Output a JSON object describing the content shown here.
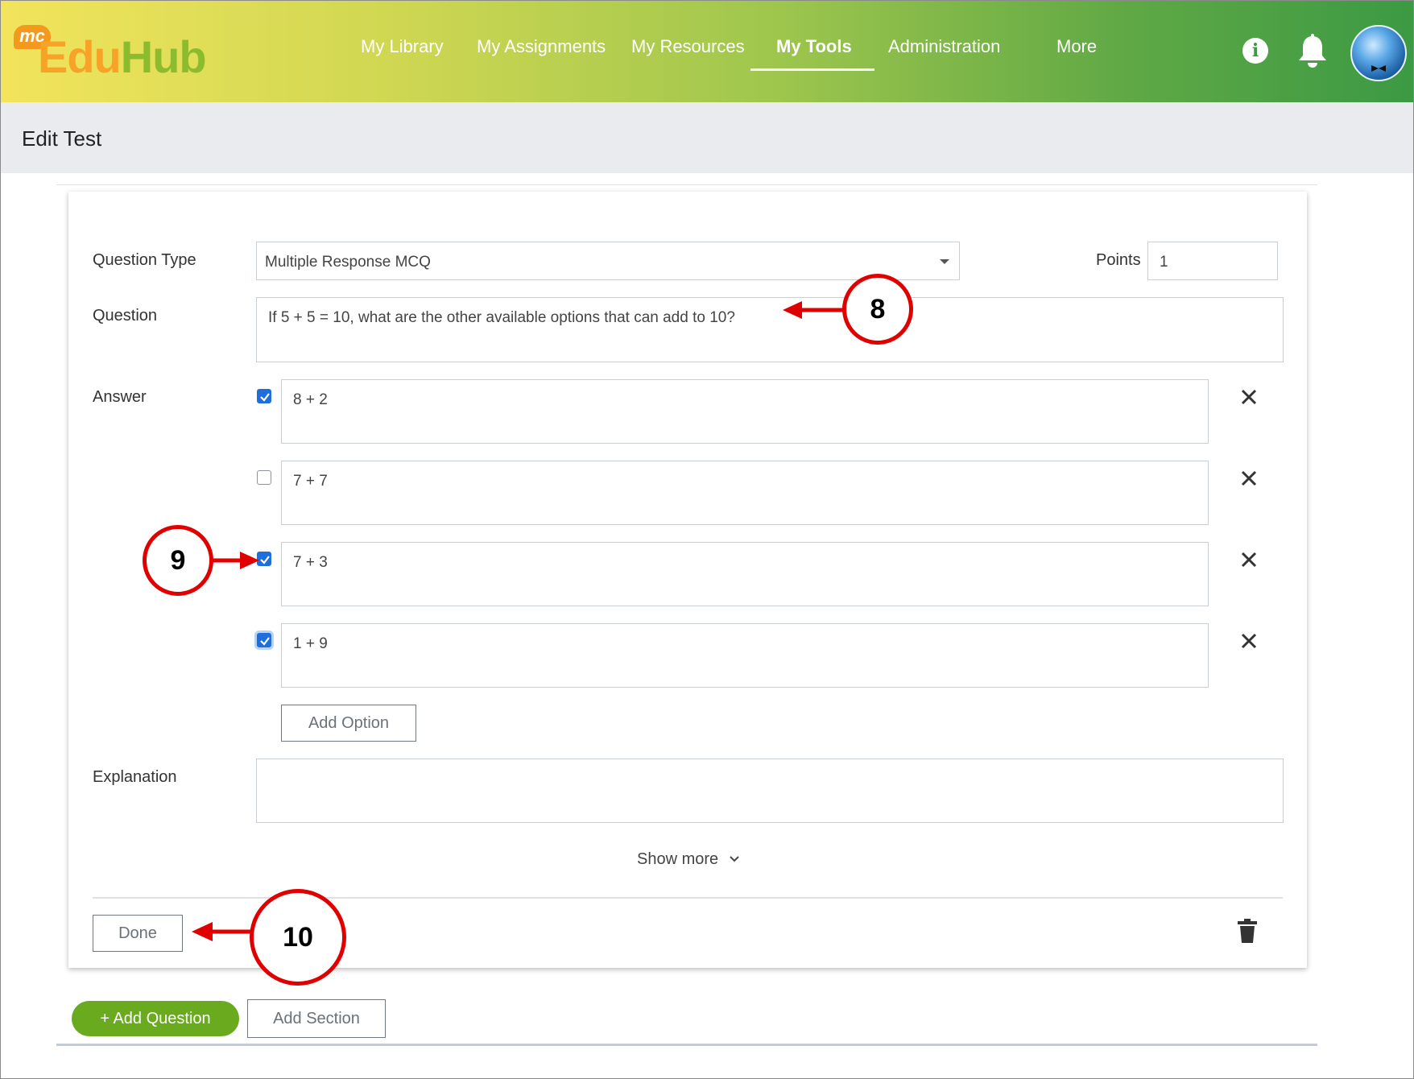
{
  "app": {
    "logo_badge": "mc",
    "logo_part1": "Edu",
    "logo_part2": "Hub"
  },
  "nav": {
    "items": [
      {
        "label": "My Library"
      },
      {
        "label": "My Assignments"
      },
      {
        "label": "My Resources"
      },
      {
        "label": "My Tools",
        "active": true
      },
      {
        "label": "Administration"
      },
      {
        "label": "More"
      }
    ]
  },
  "header_icons": {
    "info": "i",
    "info_icon": "info-icon",
    "bell_icon": "bell-icon",
    "avatar_icon": "avatar"
  },
  "page": {
    "title": "Edit Test"
  },
  "form": {
    "question_type_label": "Question Type",
    "question_type_value": "Multiple Response MCQ",
    "points_label": "Points",
    "points_value": "1",
    "question_label": "Question",
    "question_value": "If 5 + 5 = 10, what are the other available options that can add to 10?",
    "answer_label": "Answer",
    "answers": [
      {
        "text": "8 + 2",
        "checked": true
      },
      {
        "text": "7 + 7",
        "checked": false
      },
      {
        "text": "7 + 3",
        "checked": true
      },
      {
        "text": "1 + 9",
        "checked": true
      }
    ],
    "add_option_label": "Add Option",
    "explanation_label": "Explanation",
    "explanation_value": "",
    "show_more_label": "Show more",
    "done_label": "Done"
  },
  "footer": {
    "add_question_label": "+ Add Question",
    "add_section_label": "Add Section"
  },
  "annotations": {
    "callout_8": "8",
    "callout_9": "9",
    "callout_10": "10"
  },
  "colors": {
    "accent_blue": "#1e6fdb",
    "add_question_green": "#6aaa1e",
    "annotation_red": "#e00000"
  }
}
